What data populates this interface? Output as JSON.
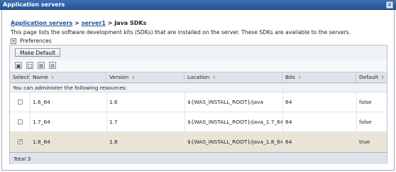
{
  "window": {
    "title": "Application servers",
    "close_glyph": "×"
  },
  "breadcrumb": {
    "link1": "Application servers",
    "sep1": ">",
    "link2": "server1",
    "sep2": ">",
    "current": "Java SDKs"
  },
  "description": "This page lists the software development kits (SDKs) that are installed on the server. These SDKs are available to the servers.",
  "preferences": {
    "label": "Preferences",
    "toggle": "+"
  },
  "buttons": {
    "make_default": "Make Default"
  },
  "toolbar_icons": [
    "select-all-icon",
    "deselect-all-icon",
    "expand-icon",
    "collapse-filter-icon"
  ],
  "table": {
    "columns": [
      {
        "key": "select",
        "label": "Select",
        "sortable": false
      },
      {
        "key": "name",
        "label": "Name",
        "sortable": true
      },
      {
        "key": "version",
        "label": "Version",
        "sortable": true
      },
      {
        "key": "location",
        "label": "Location",
        "sortable": true
      },
      {
        "key": "bits",
        "label": "Bits",
        "sortable": true
      },
      {
        "key": "default",
        "label": "Default",
        "sortable": true
      }
    ],
    "sort_glyph": "⇳",
    "resource_note": "You can administer the following resources:",
    "rows": [
      {
        "checked": false,
        "name": "1.6_64",
        "version": "1.6",
        "location": "${WAS_INSTALL_ROOT}/java",
        "bits": "64",
        "default": "false"
      },
      {
        "checked": false,
        "name": "1.7_64",
        "version": "1.7",
        "location": "${WAS_INSTALL_ROOT}/java_1.7_64",
        "bits": "64",
        "default": "false"
      },
      {
        "checked": true,
        "name": "1.8_64",
        "version": "1.8",
        "location": "${WAS_INSTALL_ROOT}/java_1.8_64",
        "bits": "64",
        "default": "true"
      }
    ],
    "total": "Total 3"
  },
  "colors": {
    "titlebar": "#2a5a9e",
    "link": "#1f4f9a",
    "selected_row": "#eae4d6",
    "header_bg": "#dfe4ea"
  }
}
